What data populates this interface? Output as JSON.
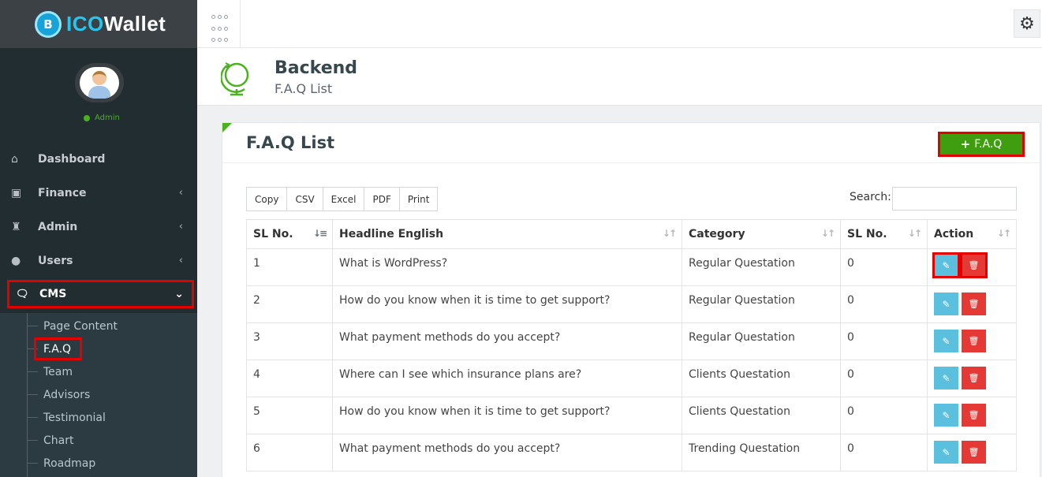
{
  "brand": {
    "prefix": "ICO",
    "suffix": "Wallet",
    "logo_glyph": "B"
  },
  "profile": {
    "status": "Admin"
  },
  "sidebar": {
    "items": [
      {
        "label": "Dashboard",
        "icon": "home-icon",
        "has_children": false
      },
      {
        "label": "Finance",
        "icon": "money-icon",
        "has_children": true
      },
      {
        "label": "Admin",
        "icon": "user-secret-icon",
        "has_children": true
      },
      {
        "label": "Users",
        "icon": "users-icon",
        "has_children": true
      },
      {
        "label": "CMS",
        "icon": "comments-icon",
        "has_children": true,
        "expanded": true
      }
    ],
    "submenu": [
      "Page Content",
      "F.A.Q",
      "Team",
      "Advisors",
      "Testimonial",
      "Chart",
      "Roadmap"
    ]
  },
  "header": {
    "title": "Backend",
    "subtitle": "F.A.Q List"
  },
  "card": {
    "title": "F.A.Q List",
    "add_button": "F.A.Q",
    "export_buttons": [
      "Copy",
      "CSV",
      "Excel",
      "PDF",
      "Print"
    ],
    "search_label": "Search:",
    "search_value": ""
  },
  "table": {
    "columns": [
      "SL No.",
      "Headline English",
      "Category",
      "SL No.",
      "Action"
    ],
    "rows": [
      {
        "sl": "1",
        "headline": "What is WordPress?",
        "category": "Regular Questation",
        "sl2": "0"
      },
      {
        "sl": "2",
        "headline": "How do you know when it is time to get support?",
        "category": "Regular Questation",
        "sl2": "0"
      },
      {
        "sl": "3",
        "headline": "What payment methods do you accept?",
        "category": "Regular Questation",
        "sl2": "0"
      },
      {
        "sl": "4",
        "headline": "Where can I see which insurance plans are?",
        "category": "Clients Questation",
        "sl2": "0"
      },
      {
        "sl": "5",
        "headline": "How do you know when it is time to get support?",
        "category": "Clients Questation",
        "sl2": "0"
      },
      {
        "sl": "6",
        "headline": "What payment methods do you accept?",
        "category": "Trending Questation",
        "sl2": "0"
      }
    ]
  },
  "colors": {
    "accent": "#4ab21f",
    "add_button": "#3f9e0f",
    "edit": "#5bc0de",
    "delete": "#e53935",
    "highlight": "#e50000"
  }
}
